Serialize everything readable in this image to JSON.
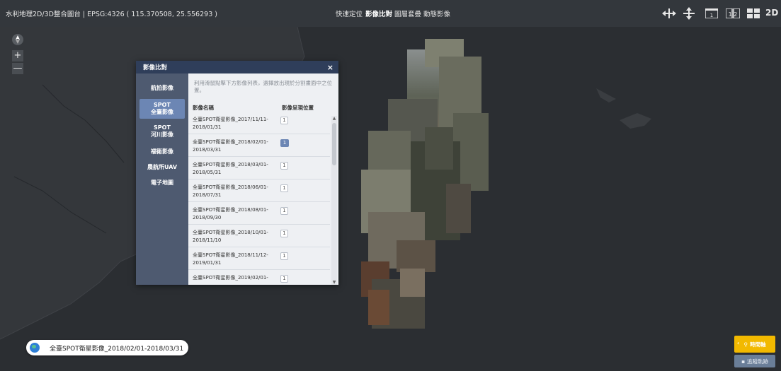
{
  "header": {
    "title": "水利地理2D/3D整合圖台 | EPSG:4326 ( 115.370508, 25.556293 )",
    "nav": [
      "快速定位",
      "影像比對",
      "圖層套疊",
      "動態影像"
    ],
    "active_nav": "影像比對",
    "mode": "2D",
    "toolbar_icons": [
      "horizontal-swipe-icon",
      "vertical-swipe-icon",
      "single-view-icon",
      "dual-view-icon",
      "quad-view-icon"
    ],
    "icon_labels": {
      "single": "1",
      "dual": "1 2"
    }
  },
  "map_controls": {
    "zoom_in": "+",
    "zoom_out": "—"
  },
  "panel": {
    "title": "影像比對",
    "close": "×",
    "categories": [
      {
        "label": "航拍影像",
        "active": false
      },
      {
        "label": "SPOT\n全臺影像",
        "active": true
      },
      {
        "label": "SPOT\n河川影像",
        "active": false
      },
      {
        "label": "福衛影像",
        "active": false
      },
      {
        "label": "農航所UAV",
        "active": false
      },
      {
        "label": "電子地圖",
        "active": false
      }
    ],
    "hint": "利用滑鼠點擊下方影像列表，選擇放出現於分割畫面中之位置。",
    "col_name": "影像名稱",
    "col_position": "影像呈現位置",
    "items": [
      {
        "name": "全臺SPOT衛星影像_2017/11/11-\n2018/01/31",
        "position": "1",
        "active": false
      },
      {
        "name": "全臺SPOT衛星影像_2018/02/01-\n2018/03/31",
        "position": "1",
        "active": true
      },
      {
        "name": "全臺SPOT衛星影像_2018/03/01-\n2018/05/31",
        "position": "1",
        "active": false
      },
      {
        "name": "全臺SPOT衛星影像_2018/06/01-\n2018/07/31",
        "position": "1",
        "active": false
      },
      {
        "name": "全臺SPOT衛星影像_2018/08/01-\n2018/09/30",
        "position": "1",
        "active": false
      },
      {
        "name": "全臺SPOT衛星影像_2018/10/01-\n2018/11/10",
        "position": "1",
        "active": false
      },
      {
        "name": "全臺SPOT衛星影像_2018/11/12-\n2019/01/31",
        "position": "1",
        "active": false
      },
      {
        "name": "全臺SPOT衛星影像_2019/02/01-",
        "position": "1",
        "active": false
      }
    ]
  },
  "layer_badge": {
    "text": "全臺SPOT衛星影像_2018/02/01-2018/03/31"
  },
  "right_buttons": {
    "timeline": "時間軸",
    "track": "追蹤軌跡"
  },
  "colors": {
    "topbar": "#33373c",
    "panel_header": "#2f3e5a",
    "category_menu": "#4e5a70",
    "active_accent": "#6c86b4",
    "timeline": "#f2b900",
    "map_bg": "#2b2e32"
  }
}
